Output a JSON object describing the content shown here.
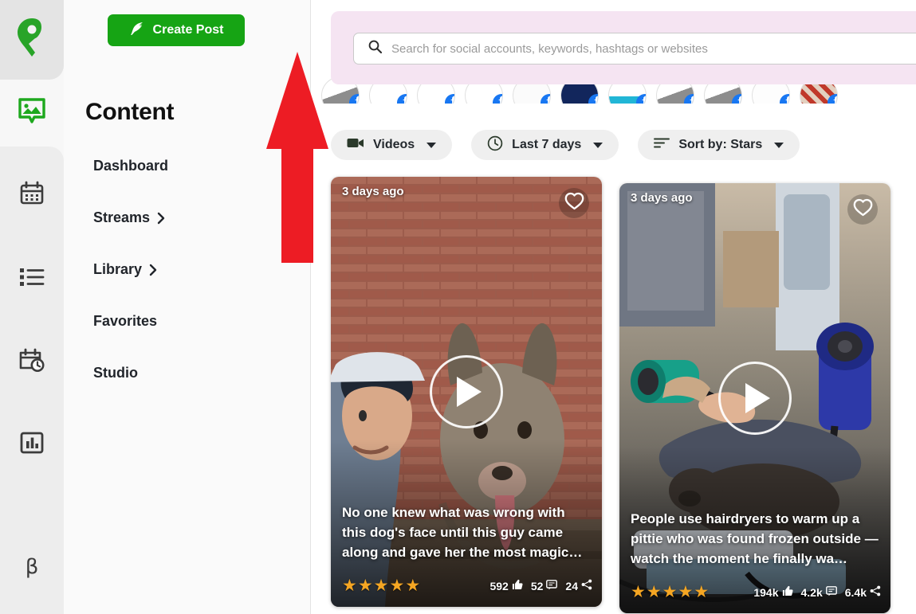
{
  "rail": {
    "logo_icon": "location-pin-logo-icon",
    "items": [
      {
        "icon": "image-post-icon",
        "name": "rail-item-content",
        "active": true
      },
      {
        "icon": "calendar-icon",
        "name": "rail-item-calendar",
        "active": false
      },
      {
        "icon": "list-icon",
        "name": "rail-item-list",
        "active": false
      },
      {
        "icon": "calendar-clock-icon",
        "name": "rail-item-schedule",
        "active": false
      },
      {
        "icon": "bar-chart-icon",
        "name": "rail-item-analytics",
        "active": false
      }
    ],
    "beta_label": "β"
  },
  "sidebar": {
    "create_post_label": "Create Post",
    "create_post_icon": "feather-icon",
    "create_post_color": "#16a414",
    "title": "Content",
    "items": [
      {
        "label": "Dashboard",
        "chevron": false
      },
      {
        "label": "Streams",
        "chevron": true
      },
      {
        "label": "Library",
        "chevron": true
      },
      {
        "label": "Favorites",
        "chevron": false
      },
      {
        "label": "Studio",
        "chevron": false
      }
    ]
  },
  "annotation": {
    "arrow_color": "#ed1c24",
    "points_to": "Create Post"
  },
  "search": {
    "placeholder": "Search for social accounts, keywords, hashtags or websites",
    "value": "",
    "icon": "search-icon",
    "panel_color": "#f5e4f2"
  },
  "accounts": {
    "badge_icon": "facebook-badge-icon",
    "badge_color": "#1877f2",
    "avatars": [
      {
        "name": "avatar-1",
        "c1": "#8d8d8d",
        "c2": "#ffffff"
      },
      {
        "name": "avatar-2",
        "c1": "#ffffff",
        "c2": "#e23b4b"
      },
      {
        "name": "avatar-3",
        "c1": "#ffffff",
        "c2": "#444444"
      },
      {
        "name": "avatar-4",
        "c1": "#ffffff",
        "c2": "#444444"
      },
      {
        "name": "avatar-5",
        "c1": "#fbfbfb",
        "c2": "#9aa0a6"
      },
      {
        "name": "avatar-6",
        "c1": "#12265c",
        "c2": "#ffffff"
      },
      {
        "name": "avatar-7",
        "c1": "#ffffff",
        "c2": "#21b6d6"
      },
      {
        "name": "avatar-8",
        "c1": "#8d8d8d",
        "c2": "#ffffff"
      },
      {
        "name": "avatar-9",
        "c1": "#8d8d8d",
        "c2": "#ffffff"
      },
      {
        "name": "avatar-10",
        "c1": "#fdfdfd",
        "c2": "#6b6b6b"
      },
      {
        "name": "avatar-11",
        "c1": "#e3d0c0",
        "c2": "#c0392b"
      }
    ]
  },
  "filters": [
    {
      "label": "Videos",
      "icon": "video-camera-icon",
      "name": "filter-type"
    },
    {
      "label": "Last 7 days",
      "icon": "clock-icon",
      "name": "filter-date-range"
    },
    {
      "label": "Sort by: Stars",
      "icon": "sort-icon",
      "name": "filter-sort"
    }
  ],
  "cards": [
    {
      "age": "3 days ago",
      "caption": "No one knew what was wrong with this dog's face until this guy came along and gave her the most magic…",
      "stars": 5,
      "likes": "592",
      "comments": "52",
      "shares": "24",
      "favorite_icon": "heart-icon",
      "play_icon": "play-icon"
    },
    {
      "age": "3 days ago",
      "caption": "People use hairdryers to warm up a pittie who was found frozen outside — watch the moment he finally wa…",
      "stars": 5,
      "likes": "194k",
      "comments": "4.2k",
      "shares": "6.4k",
      "favorite_icon": "heart-icon",
      "play_icon": "play-icon"
    }
  ],
  "icons": {
    "like": "thumbs-up-icon",
    "comment": "comment-icon",
    "share": "share-icon",
    "star": "★"
  }
}
